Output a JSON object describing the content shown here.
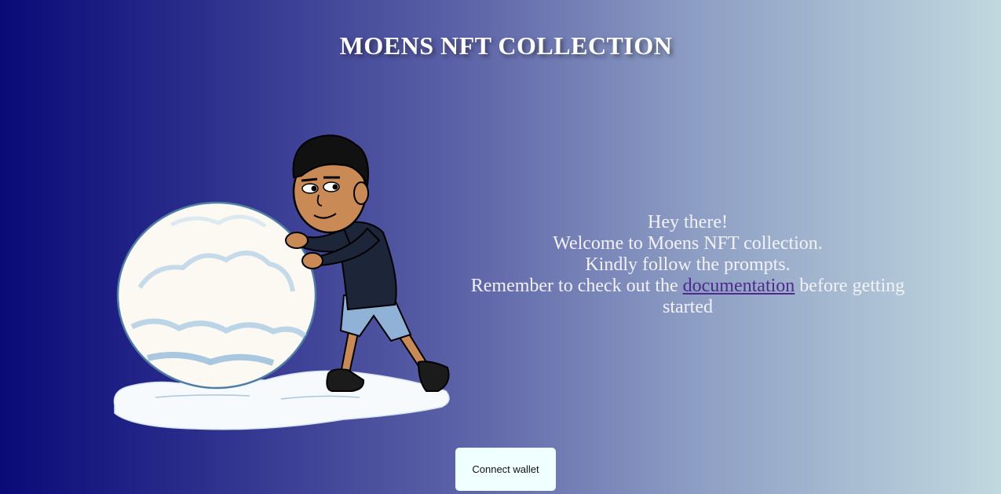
{
  "header": {
    "title": "MOENS NFT COLLECTION"
  },
  "hero": {
    "illustration": "avatar-pushing-snowball-icon"
  },
  "welcome": {
    "line1": "Hey there!",
    "line2": "Welcome to Moens NFT collection.",
    "line3": "Kindly follow the prompts.",
    "line4_prefix": "Remember to check out the",
    "line4_link": "documentation",
    "line4_suffix": "before getting started"
  },
  "actions": {
    "connect_label": "Connect wallet"
  },
  "colors": {
    "gradient_start": "#0a0a78",
    "gradient_end": "#c1d8df",
    "link": "#4d2a8c",
    "button_bg": "#f0ffff"
  }
}
